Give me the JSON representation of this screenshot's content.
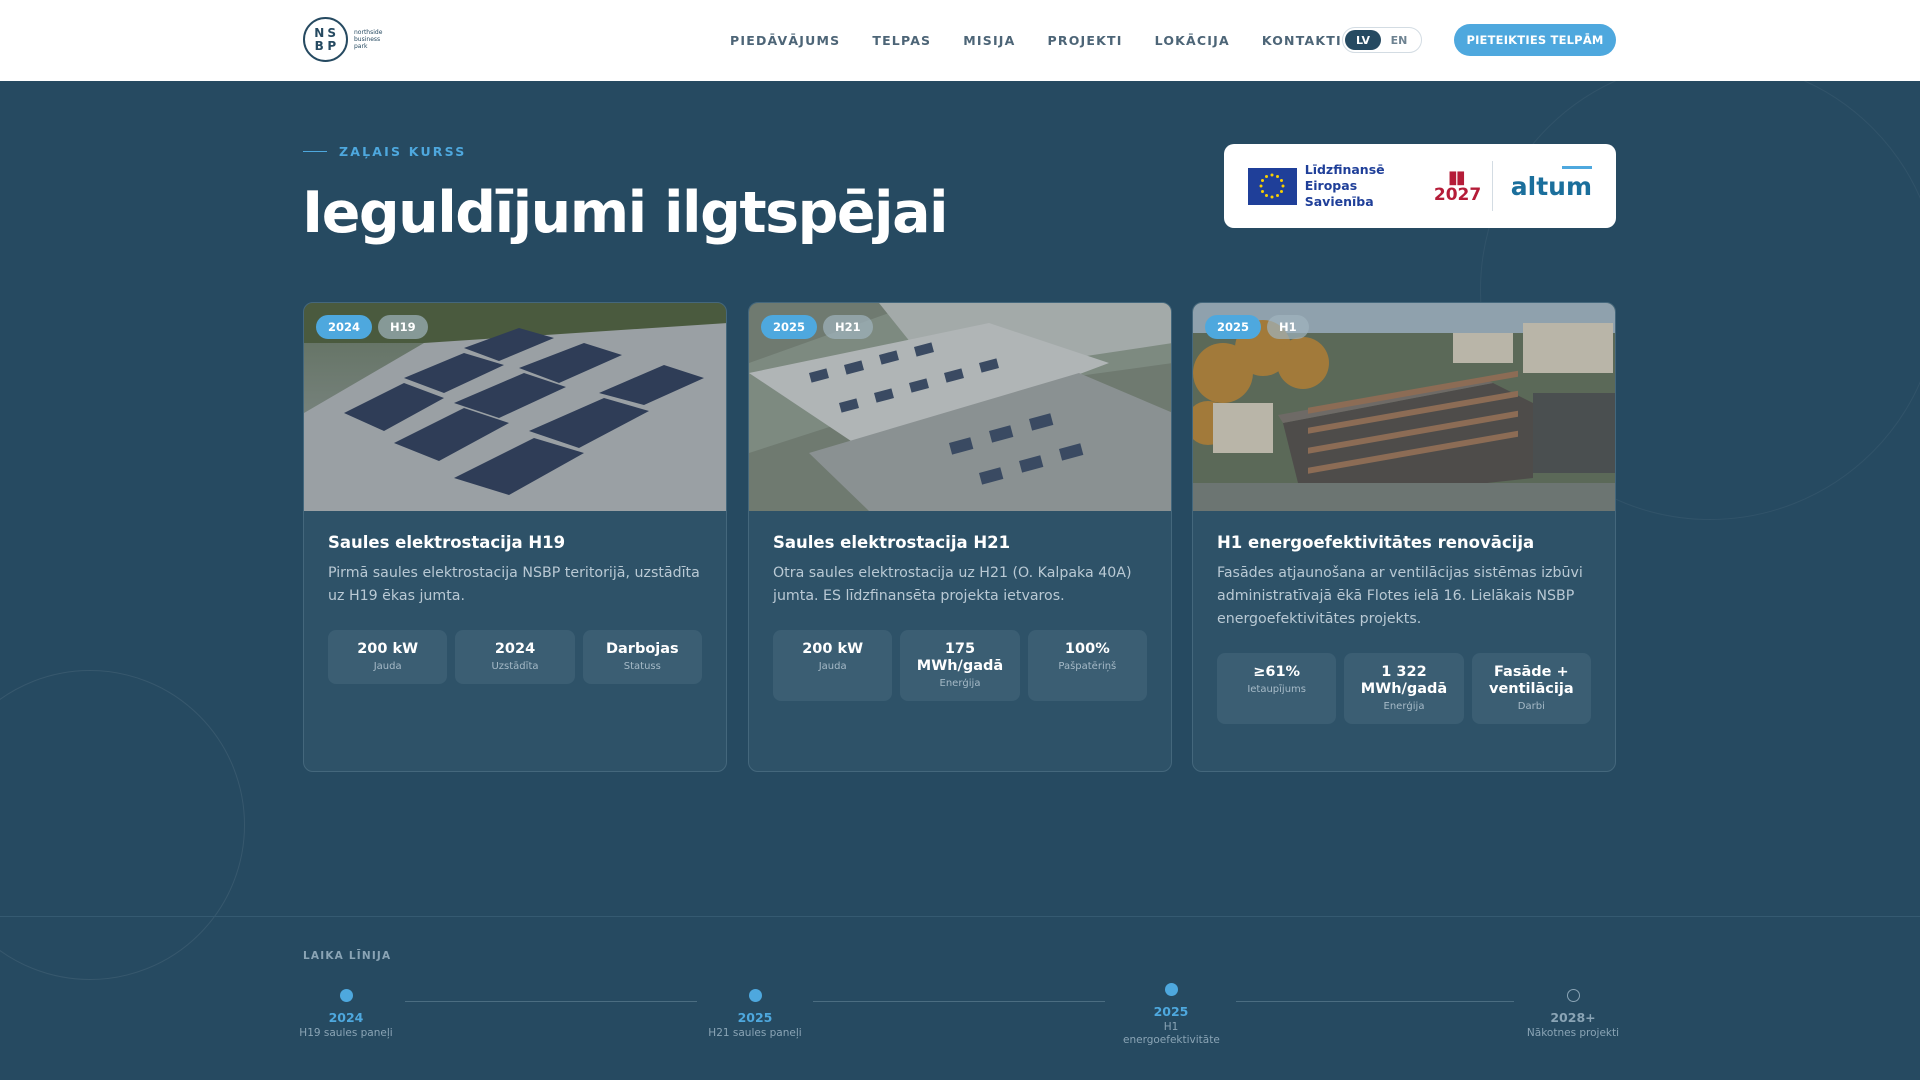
{
  "brand": {
    "logo_letters": [
      "N",
      "S",
      "B",
      "P"
    ],
    "logo_text": "northside business park"
  },
  "nav": {
    "links": [
      "PIEDĀVĀJUMS",
      "TELPAS",
      "MISIJA",
      "PROJEKTI",
      "LOKĀCIJA",
      "KONTAKTI"
    ],
    "lang": [
      "LV",
      "EN"
    ],
    "lang_active": "LV",
    "cta": "PIETEIKTIES TELPĀM"
  },
  "hero": {
    "eyebrow": "ZAĻAIS KURSS",
    "title": "Ieguldījumi ilgtspējai"
  },
  "funding": {
    "eu_text": "Līdzfinansē Eiropas Savienība",
    "logo_2027": "2027",
    "altum": "altum"
  },
  "cards": [
    {
      "year": "2024",
      "code": "H19",
      "title": "Saules elektrostacija H19",
      "desc": "Pirmā saules elektrostacija NSBP teritorijā, uzstādīta uz H19 ēkas jumta.",
      "stats": [
        {
          "value": "200 kW",
          "label": "Jauda"
        },
        {
          "value": "2024",
          "label": "Uzstādīta"
        },
        {
          "value": "Darbojas",
          "label": "Statuss"
        }
      ]
    },
    {
      "year": "2025",
      "code": "H21",
      "title": "Saules elektrostacija H21",
      "desc": "Otra saules elektrostacija uz H21 (O. Kalpaka 40A) jumta. ES līdzfinansēta projekta ietvaros.",
      "stats": [
        {
          "value": "200 kW",
          "label": "Jauda"
        },
        {
          "value": "175 MWh/gadā",
          "label": "Enerģija"
        },
        {
          "value": "100%",
          "label": "Pašpatēriņš"
        }
      ]
    },
    {
      "year": "2025",
      "code": "H1",
      "title": "H1 energoefektivitātes renovācija",
      "desc": "Fasādes atjaunošana ar ventilācijas sistēmas izbūvi administratīvajā ēkā Flotes ielā 16. Lielākais NSBP energoefektivitātes projekts.",
      "stats": [
        {
          "value": "≥61%",
          "label": "Ietaupījums"
        },
        {
          "value": "1 322 MWh/gadā",
          "label": "Enerģija"
        },
        {
          "value": "Fasāde + ventilācija",
          "label": "Darbi"
        }
      ]
    }
  ],
  "timeline": {
    "title": "LAIKA LĪNIJA",
    "items": [
      {
        "year": "2024",
        "label": "H19 saules paneļi",
        "future": false
      },
      {
        "year": "2025",
        "label": "H21 saules paneļi",
        "future": false
      },
      {
        "year": "2025",
        "label": "H1 energoefektivitāte",
        "future": false
      },
      {
        "year": "2028+",
        "label": "Nākotnes projekti",
        "future": true
      }
    ]
  },
  "colors": {
    "background": "#264a61",
    "accent": "#4ea8de",
    "card": "#2e5268"
  }
}
